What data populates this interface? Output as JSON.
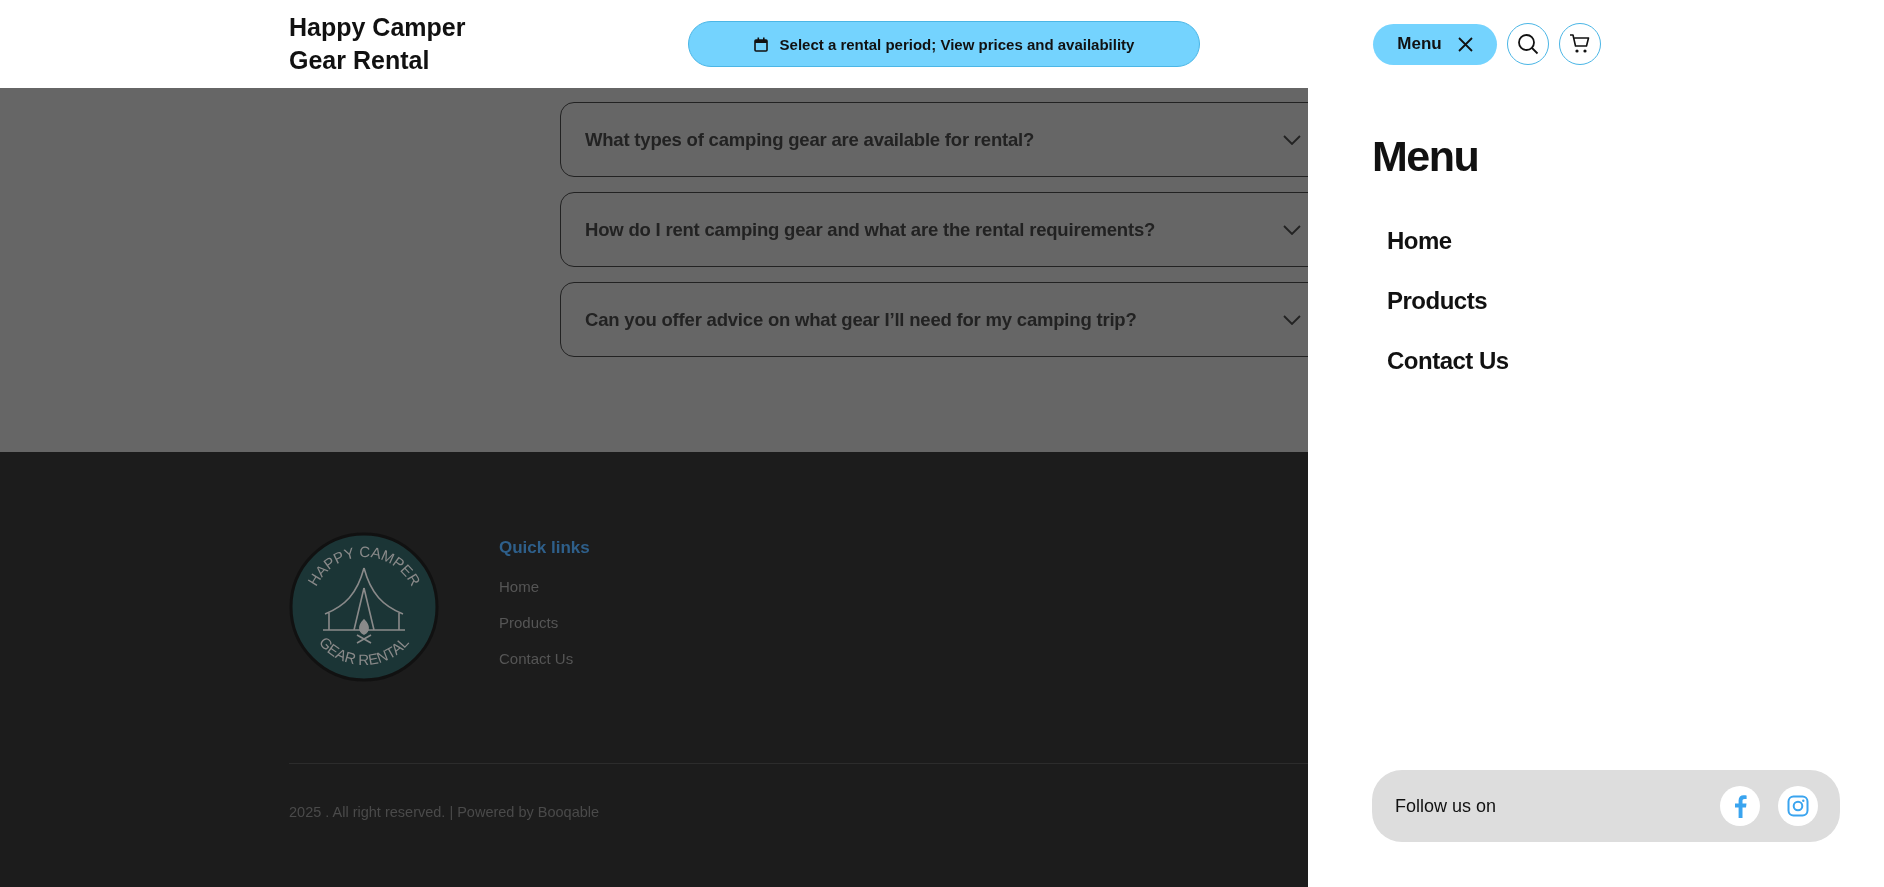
{
  "header": {
    "brand": [
      "Happy Camper",
      "Gear Rental"
    ],
    "booking_button": "Select a rental period; View prices and availability",
    "menu_button": "Menu"
  },
  "faq": [
    {
      "question": "What types of camping gear are available for rental?",
      "expanded": false
    },
    {
      "question": "How do I rent camping gear and what are the rental requirements?",
      "expanded": false
    },
    {
      "question": "Can you offer advice on what gear I’ll need for my camping trip?",
      "expanded": false
    }
  ],
  "footer": {
    "logo": {
      "top_text": "HAPPY CAMPER",
      "bottom_text": "GEAR RENTAL"
    },
    "quick_links_title": "Quick links",
    "quick_links": [
      "Home",
      "Products",
      "Contact Us"
    ],
    "copyright": "2025 . All right reserved. | Powered by Booqable"
  },
  "menu_panel": {
    "title": "Menu",
    "items": [
      "Home",
      "Products",
      "Contact Us"
    ],
    "follow_text": "Follow us on"
  }
}
